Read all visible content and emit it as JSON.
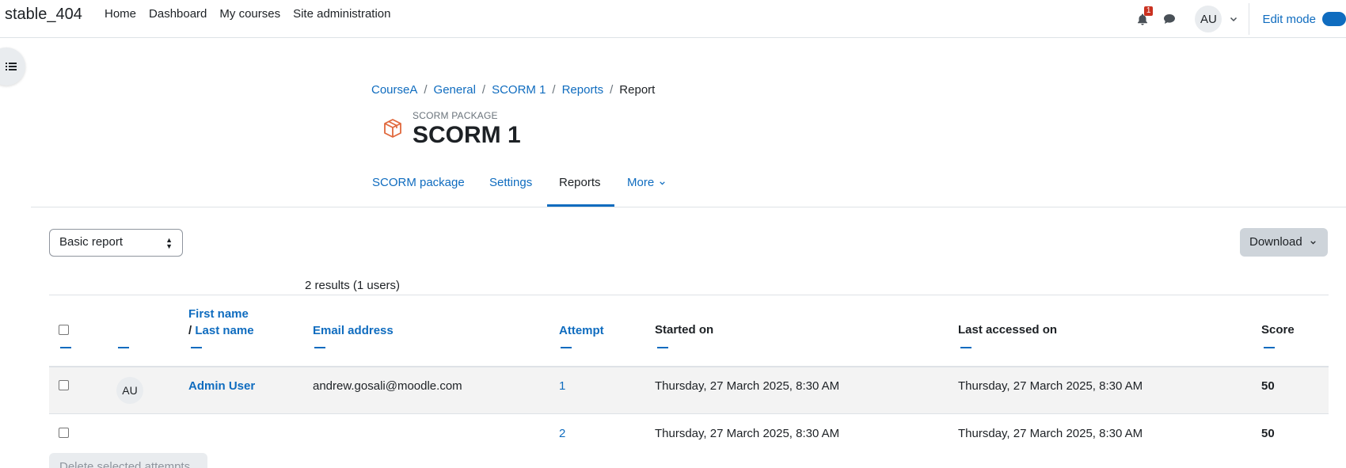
{
  "navbar": {
    "brand": "stable_404",
    "items": [
      "Home",
      "Dashboard",
      "My courses",
      "Site administration"
    ],
    "notification_count": "1",
    "user_initials": "AU",
    "edit_mode_label": "Edit mode"
  },
  "breadcrumb": {
    "items": [
      "CourseA",
      "General",
      "SCORM 1",
      "Reports"
    ],
    "current": "Report",
    "separator": "/"
  },
  "header": {
    "pre_title": "SCORM PACKAGE",
    "title": "SCORM 1",
    "icon": "package-box-icon",
    "icon_color": "#e0683c"
  },
  "secondary_nav": {
    "tabs": [
      "SCORM package",
      "Settings",
      "Reports",
      "More"
    ],
    "active": "Reports"
  },
  "controls": {
    "report_type": "Basic report",
    "download_label": "Download",
    "results_text": "2 results (1 users)"
  },
  "table": {
    "headers": {
      "first_name": "First name",
      "name_separator": "/",
      "last_name": "Last name",
      "email": "Email address",
      "attempt": "Attempt",
      "started_on": "Started on",
      "last_accessed": "Last accessed on",
      "score": "Score"
    },
    "rows": [
      {
        "avatar": "AU",
        "name": "Admin User",
        "email": "andrew.gosali@moodle.com",
        "attempt": "1",
        "started_on": "Thursday, 27 March 2025, 8:30 AM",
        "last_accessed": "Thursday, 27 March 2025, 8:30 AM",
        "score": "50"
      },
      {
        "avatar": "",
        "name": "",
        "email": "",
        "attempt": "2",
        "started_on": "Thursday, 27 March 2025, 8:30 AM",
        "last_accessed": "Thursday, 27 March 2025, 8:30 AM",
        "score": "50"
      }
    ]
  },
  "footer": {
    "delete_label": "Delete selected attempts"
  },
  "colors": {
    "link": "#0f6cbf",
    "badge": "#ca3120",
    "row_highlight": "#f3f3f3"
  }
}
